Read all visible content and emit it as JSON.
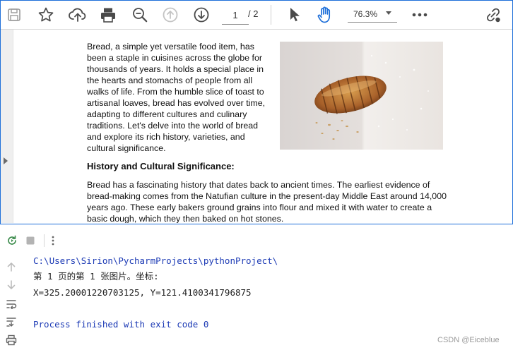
{
  "pdf_viewer": {
    "toolbar": {
      "icons": [
        "save-icon",
        "bookmark-star-icon",
        "upload-cloud-icon",
        "print-icon",
        "zoom-search-icon",
        "page-up-icon",
        "page-down-icon",
        "select-cursor-icon",
        "hand-tool-icon",
        "more-options-icon",
        "share-link-icon"
      ],
      "current_page": "1",
      "total_pages": "/ 2",
      "zoom": "76.3%"
    },
    "document": {
      "para1": "Bread, a simple yet versatile food item, has been a staple in cuisines across the globe for thousands of years. It holds a special place in the hearts and stomachs of people from all walks of life. From the humble slice of toast to artisanal loaves, bread has evolved over time, adapting to different cultures and culinary traditions. Let's delve into the world of bread and explore its rich history, varieties, and cultural significance.",
      "heading": "History and Cultural Significance:",
      "para2": "Bread has a fascinating history that dates back to ancient times. The earliest evidence of bread-making comes from the Natufian culture in the present-day Middle East around 14,000 years ago. These early bakers ground grains into flour and mixed it with water to create a basic dough, which they then baked on hot stones."
    }
  },
  "console": {
    "toolbar_icons": [
      "rerun-icon",
      "stop-icon",
      "more-vertical-icon"
    ],
    "gutter_icons": [
      "arrow-up-icon",
      "arrow-down-icon",
      "soft-wrap-icon",
      "scroll-to-end-icon",
      "print-icon"
    ],
    "lines": [
      "C:\\Users\\Sirion\\PycharmProjects\\pythonProject\\",
      "第 1 页的第 1 张图片。坐标:",
      "X=325.20001220703125, Y=121.4100341796875",
      "Process finished with exit code 0"
    ]
  },
  "watermark": "CSDN @Eiceblue",
  "colors": {
    "accent": "#1e6fd9",
    "console_blue": "#1d3bb5",
    "icon": "#555555"
  }
}
